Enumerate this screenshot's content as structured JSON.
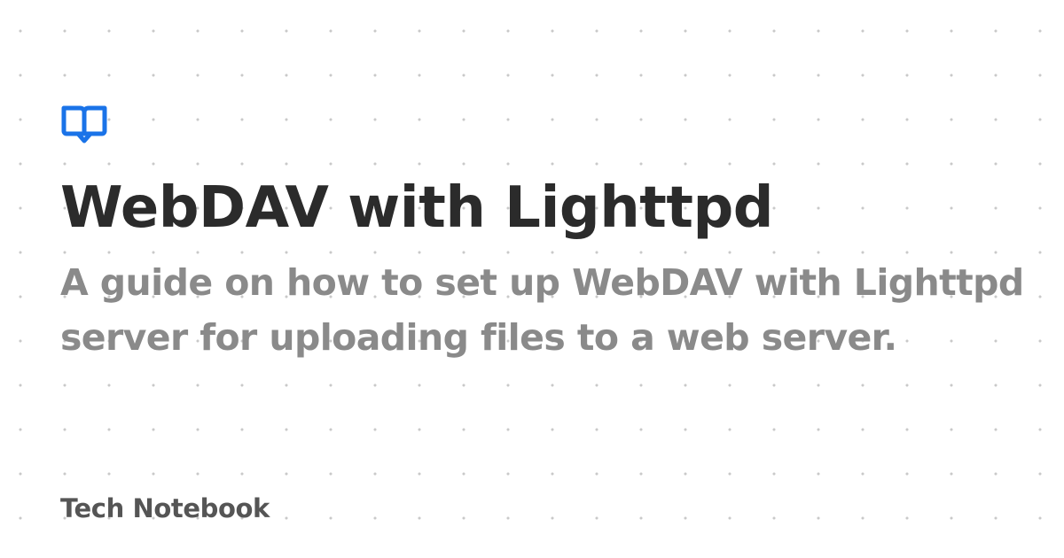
{
  "brand": {
    "icon": "book-icon",
    "accent_color": "#1a73e8"
  },
  "article": {
    "title": "WebDAV with Lighttpd",
    "subtitle": "A guide on how to set up WebDAV with Lighttpd server for uploading files to a web server."
  },
  "site": {
    "name": "Tech Notebook"
  }
}
